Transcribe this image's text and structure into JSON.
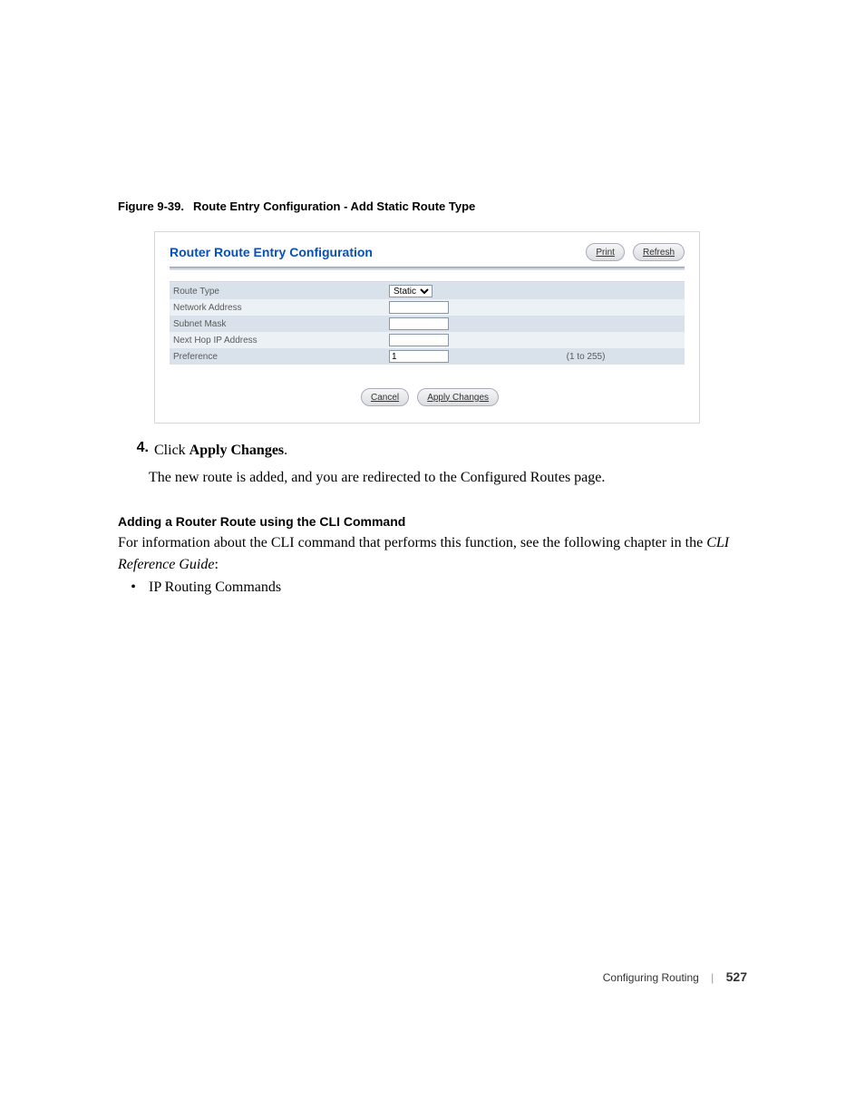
{
  "figure": {
    "label": "Figure 9-39.",
    "title": "Route Entry Configuration - Add Static Route Type"
  },
  "panel": {
    "title": "Router Route Entry Configuration",
    "print": "Print",
    "refresh": "Refresh",
    "rows": {
      "route_type_label": "Route Type",
      "route_type_value": "Static",
      "network_address_label": "Network Address",
      "subnet_mask_label": "Subnet Mask",
      "next_hop_label": "Next Hop IP Address",
      "preference_label": "Preference",
      "preference_value": "1",
      "preference_hint": "(1 to 255)"
    },
    "cancel": "Cancel",
    "apply": "Apply Changes"
  },
  "step": {
    "number": "4.",
    "text_prefix": "Click ",
    "text_bold": "Apply Changes",
    "text_suffix": ".",
    "follow": "The new route is added, and you are redirected to the Configured Routes page."
  },
  "cli": {
    "heading": "Adding a Router Route using the CLI Command",
    "para_prefix": "For information about the CLI command that performs this function, see the following chapter in the ",
    "para_italic": "CLI Reference Guide",
    "para_suffix": ":",
    "bullet": "IP Routing Commands"
  },
  "footer": {
    "section": "Configuring Routing",
    "page": "527"
  }
}
